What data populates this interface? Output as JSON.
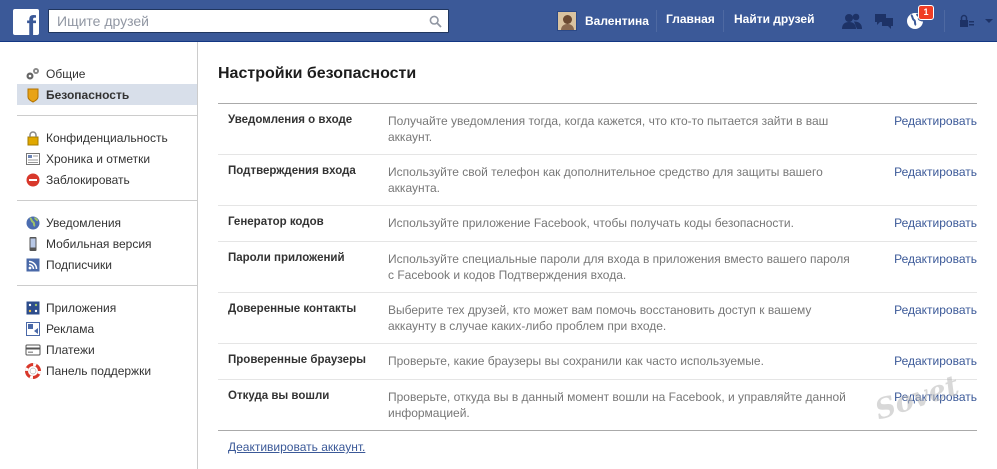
{
  "header": {
    "logo": "f",
    "search_placeholder": "Ищите друзей",
    "user_name": "Валентина",
    "home": "Главная",
    "find_friends": "Найти друзей",
    "notifications_count": "1",
    "brand_color": "#3b5998"
  },
  "sidebar": {
    "groups": [
      [
        {
          "label": "Общие",
          "icon": "gears-icon"
        },
        {
          "label": "Безопасность",
          "icon": "shield-badge-icon",
          "active": true
        }
      ],
      [
        {
          "label": "Конфиденциальность",
          "icon": "lock-icon"
        },
        {
          "label": "Хроника и отметки",
          "icon": "timeline-icon"
        },
        {
          "label": "Заблокировать",
          "icon": "block-icon"
        }
      ],
      [
        {
          "label": "Уведомления",
          "icon": "globe-icon"
        },
        {
          "label": "Мобильная версия",
          "icon": "mobile-icon"
        },
        {
          "label": "Подписчики",
          "icon": "rss-icon"
        }
      ],
      [
        {
          "label": "Приложения",
          "icon": "apps-icon"
        },
        {
          "label": "Реклама",
          "icon": "ads-icon"
        },
        {
          "label": "Платежи",
          "icon": "card-icon"
        },
        {
          "label": "Панель поддержки",
          "icon": "lifebuoy-icon"
        }
      ]
    ]
  },
  "main": {
    "title": "Настройки безопасности",
    "edit_label": "Редактировать",
    "rows": [
      {
        "name": "Уведомления о входе",
        "desc": "Получайте уведомления тогда, когда кажется, что кто-то пытается зайти в ваш аккаунт."
      },
      {
        "name": "Подтверждения входа",
        "desc": "Используйте свой телефон как дополнительное средство для защиты вашего аккаунта."
      },
      {
        "name": "Генератор кодов",
        "desc": "Используйте приложение Facebook, чтобы получать коды безопасности."
      },
      {
        "name": "Пароли приложений",
        "desc": "Используйте специальные пароли для входа в приложения вместо вашего пароля с Facebook и кодов Подтверждения входа."
      },
      {
        "name": "Доверенные контакты",
        "desc": "Выберите тех друзей, кто может вам помочь восстановить доступ к вашему аккаунту в случае каких-либо проблем при входе."
      },
      {
        "name": "Проверенные браузеры",
        "desc": "Проверьте, какие браузеры вы сохранили как часто используемые."
      },
      {
        "name": "Откуда вы вошли",
        "desc": "Проверьте, откуда вы в данный момент вошли на Facebook, и управляйте данной информацией."
      }
    ],
    "deactivate": "Деактивировать аккаунт."
  },
  "watermark": "Sovet"
}
